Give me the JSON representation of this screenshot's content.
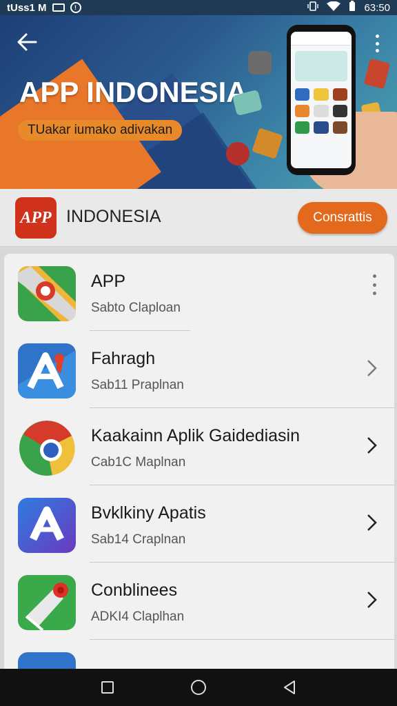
{
  "status_bar": {
    "left_text": "tUss1 M",
    "time": "63:50",
    "left_icons": [
      "message-icon",
      "notification-icon"
    ],
    "right_icons": [
      "vibrate-icon",
      "wifi-icon",
      "battery-icon"
    ]
  },
  "banner": {
    "title": "APP INDONESIA",
    "tagline": "TUakar iumako adivakan",
    "back_icon": "arrow-left-icon",
    "menu_icon": "more-vertical-icon",
    "colors": {
      "primary": "#2b5a8e",
      "accent": "#e98a2a"
    }
  },
  "header": {
    "logo_text": "APP",
    "app_name": "INDONESIA",
    "button_label": "Consrattis",
    "button_color": "#e36a1c"
  },
  "list": {
    "items": [
      {
        "title": "APP",
        "subtitle": "Sabto Claploan",
        "trailing": "more-vertical-icon"
      },
      {
        "title": "Fahragh",
        "subtitle": "Sab11 Praplnan",
        "trailing": "chevron-right-icon"
      },
      {
        "title": "Kaakainn Aplik Gaidediasin",
        "subtitle": "Cab1C Maplnan",
        "trailing": "chevron-right-icon"
      },
      {
        "title": "Bvklkiny Apatis",
        "subtitle": "Sab14 Craplnan",
        "trailing": "chevron-right-icon"
      },
      {
        "title": "Conblinees",
        "subtitle": "ADKI4 Claplhan",
        "trailing": "chevron-right-icon"
      }
    ]
  },
  "nav_bar": {
    "buttons": [
      "recents-icon",
      "home-icon",
      "back-icon"
    ]
  }
}
